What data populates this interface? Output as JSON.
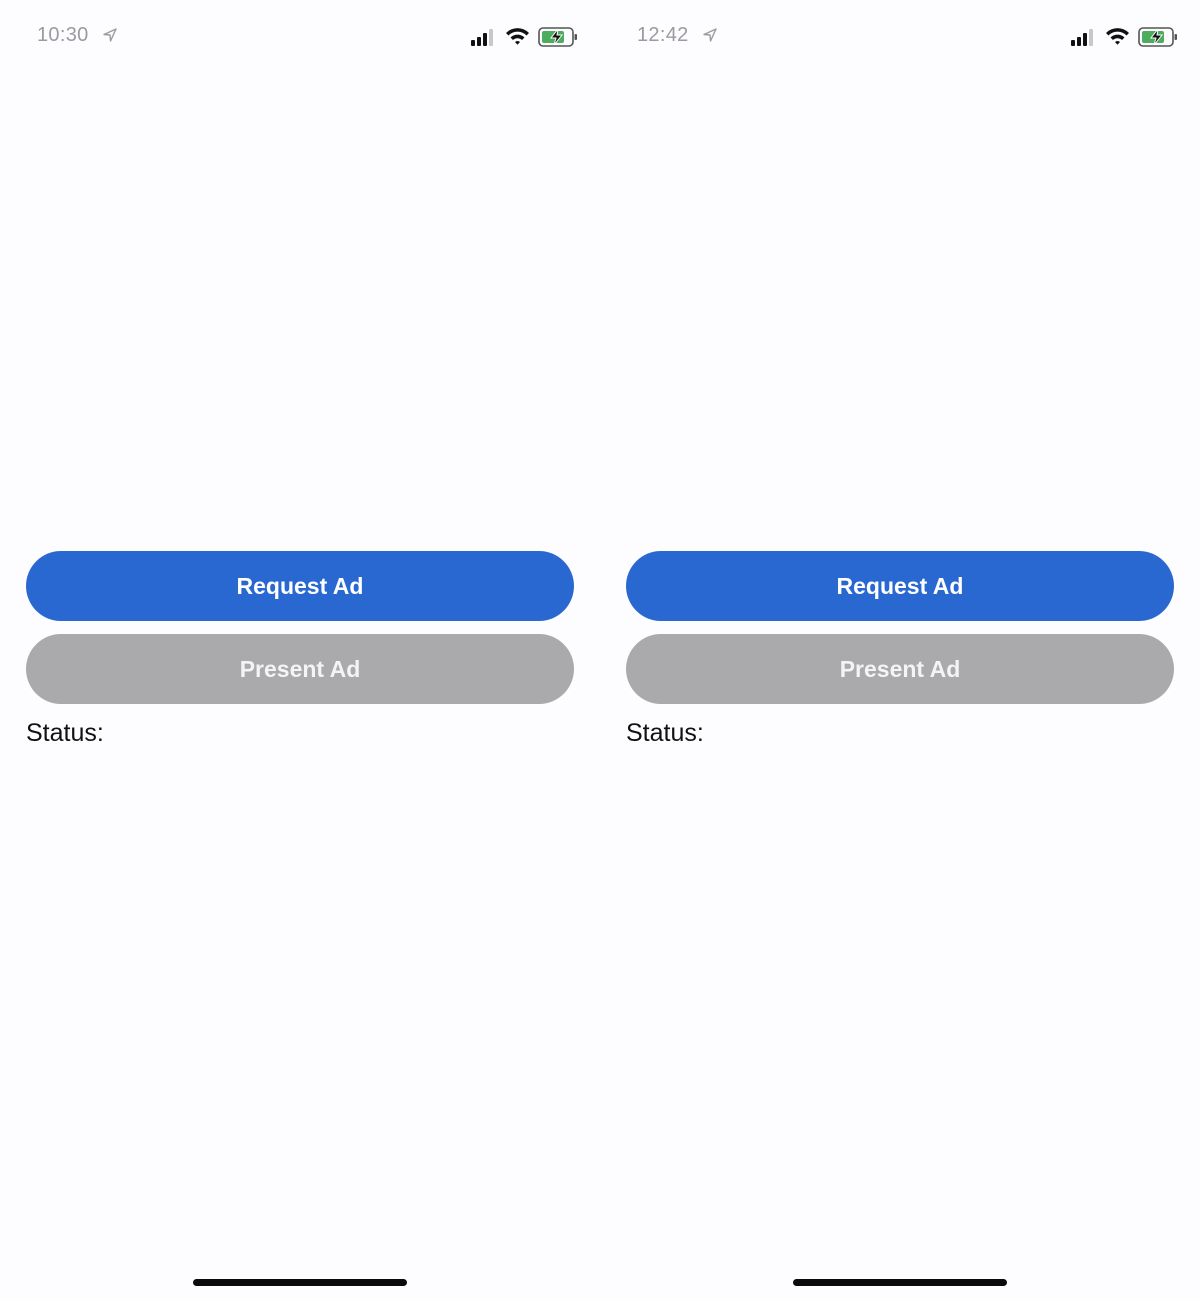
{
  "screens": [
    {
      "status_bar": {
        "time": "10:30",
        "icons": [
          "location-arrow-icon",
          "cellular-signal-icon",
          "wifi-icon",
          "battery-charging-icon"
        ]
      },
      "buttons": {
        "request_label": "Request Ad",
        "present_label": "Present Ad"
      },
      "status_label": "Status:"
    },
    {
      "status_bar": {
        "time": "12:42",
        "icons": [
          "location-arrow-icon",
          "cellular-signal-icon",
          "wifi-icon",
          "battery-charging-icon"
        ]
      },
      "buttons": {
        "request_label": "Request Ad",
        "present_label": "Present Ad"
      },
      "status_label": "Status:"
    }
  ],
  "colors": {
    "background": "#fdfcff",
    "primary_button": "#2a68d1",
    "disabled_button": "#aaa9ac",
    "time_text": "#9a9aa0",
    "battery_fill": "#4cae5c"
  }
}
